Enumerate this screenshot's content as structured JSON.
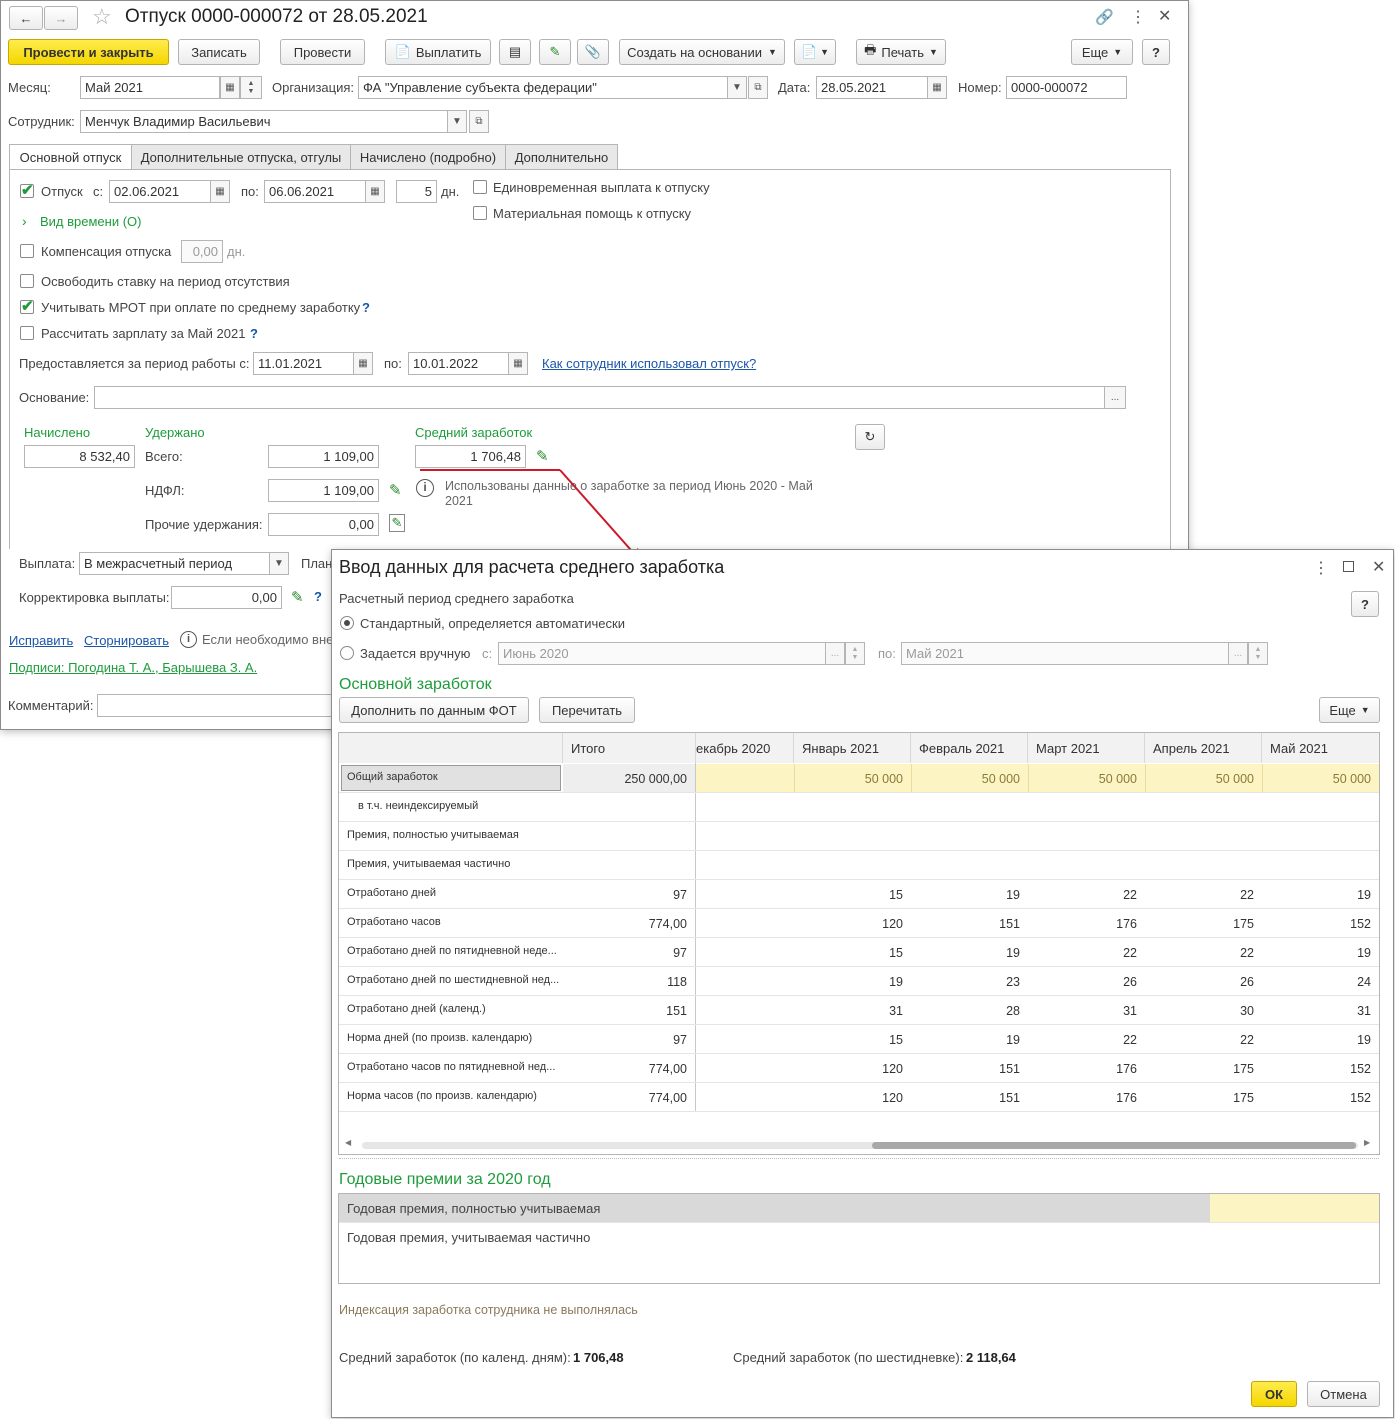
{
  "main_window": {
    "title": "Отпуск 0000-000072 от 28.05.2021",
    "toolbar": {
      "post_close": "Провести и закрыть",
      "save": "Записать",
      "post": "Провести",
      "pay": "Выплатить",
      "create_based": "Создать на основании",
      "print": "Печать",
      "more": "Еще",
      "help": "?"
    },
    "header": {
      "month_label": "Месяц:",
      "month_value": "Май 2021",
      "org_label": "Организация:",
      "org_value": "ФА \"Управление субъекта федерации\"",
      "date_label": "Дата:",
      "date_value": "28.05.2021",
      "number_label": "Номер:",
      "number_value": "0000-000072",
      "employee_label": "Сотрудник:",
      "employee_value": "Менчук Владимир Васильевич"
    },
    "tabs": [
      "Основной отпуск",
      "Дополнительные отпуска, отгулы",
      "Начислено (подробно)",
      "Дополнительно"
    ],
    "leave": {
      "vacation_label": "Отпуск",
      "from_label": "с:",
      "from_value": "02.06.2021",
      "to_label": "по:",
      "to_value": "06.06.2021",
      "days_value": "5",
      "days_unit": "дн.",
      "lump_sum": "Единовременная выплата к отпуску",
      "material_aid": "Материальная помощь к отпуску",
      "time_type": "Вид времени (О)",
      "compensation": "Компенсация отпуска",
      "compensation_value": "0,00",
      "compensation_unit": "дн.",
      "free_rate": "Освободить ставку на период отсутствия",
      "mrot": "Учитывать МРОТ при оплате по среднему заработку",
      "calc_salary": "Рассчитать зарплату за Май 2021",
      "period_label": "Предоставляется за период работы с:",
      "period_from": "11.01.2021",
      "period_to_label": "по:",
      "period_to": "10.01.2022",
      "usage_link": "Как сотрудник использовал отпуск?",
      "basis_label": "Основание:"
    },
    "totals": {
      "accrued_label": "Начислено",
      "accrued_value": "8 532,40",
      "withheld_label": "Удержано",
      "total_label": "Всего:",
      "total_value": "1 109,00",
      "ndfl_label": "НДФЛ:",
      "ndfl_value": "1 109,00",
      "other_label": "Прочие удержания:",
      "other_value": "0,00",
      "avg_label": "Средний заработок",
      "avg_value": "1 706,48",
      "info_text": "Использованы данные о заработке за период Июнь 2020 - Май 2021"
    },
    "payment": {
      "pay_label": "Выплата:",
      "pay_value": "В межрасчетный период",
      "plan_label": "План",
      "correction_label": "Корректировка выплаты:",
      "correction_value": "0,00"
    },
    "footer": {
      "fix_link": "Исправить",
      "reverse_link": "Сторнировать",
      "note_text": "Если необходимо вне",
      "signatures_link": "Подписи: Погодина Т. А., Барышева З. А.",
      "comment_label": "Комментарий:"
    }
  },
  "dialog": {
    "title": "Ввод данных для расчета среднего заработка",
    "period_section": "Расчетный период среднего заработка",
    "radio_auto": "Стандартный, определяется автоматически",
    "radio_manual": "Задается вручную",
    "manual_from_label": "с:",
    "manual_from": "Июнь 2020",
    "manual_to_label": "по:",
    "manual_to": "Май 2021",
    "base_section": "Основной заработок",
    "fill_button": "Дополнить по данным ФОТ",
    "reread_button": "Перечитать",
    "more_button": "Еще",
    "help": "?",
    "table": {
      "columns": [
        "",
        "Итого",
        "екабрь 2020",
        "Январь 2021",
        "Февраль 2021",
        "Март 2021",
        "Апрель 2021",
        "Май 2021"
      ],
      "rows": [
        {
          "label": "Общий заработок",
          "total": "250 000,00",
          "values": [
            "",
            "50 000",
            "50 000",
            "50 000",
            "50 000",
            "50 000"
          ]
        },
        {
          "label": "в т.ч. неиндексируемый",
          "total": "",
          "values": [
            "",
            "",
            "",
            "",
            "",
            ""
          ]
        },
        {
          "label": "Премия, полностью учитываемая",
          "total": "",
          "values": [
            "",
            "",
            "",
            "",
            "",
            ""
          ]
        },
        {
          "label": "Премия, учитываемая частично",
          "total": "",
          "values": [
            "",
            "",
            "",
            "",
            "",
            ""
          ]
        },
        {
          "label": "Отработано дней",
          "total": "97",
          "values": [
            "",
            "15",
            "19",
            "22",
            "22",
            "19"
          ]
        },
        {
          "label": "Отработано часов",
          "total": "774,00",
          "values": [
            "",
            "120",
            "151",
            "176",
            "175",
            "152"
          ]
        },
        {
          "label": "Отработано дней по пятидневной неде...",
          "total": "97",
          "values": [
            "",
            "15",
            "19",
            "22",
            "22",
            "19"
          ]
        },
        {
          "label": "Отработано дней по шестидневной нед...",
          "total": "118",
          "values": [
            "",
            "19",
            "23",
            "26",
            "26",
            "24"
          ]
        },
        {
          "label": "Отработано дней (календ.)",
          "total": "151",
          "values": [
            "",
            "31",
            "28",
            "31",
            "30",
            "31"
          ]
        },
        {
          "label": "Норма дней (по произв. календарю)",
          "total": "97",
          "values": [
            "",
            "15",
            "19",
            "22",
            "22",
            "19"
          ]
        },
        {
          "label": "Отработано часов по пятидневной нед...",
          "total": "774,00",
          "values": [
            "",
            "120",
            "151",
            "176",
            "175",
            "152"
          ]
        },
        {
          "label": "Норма часов (по произв. календарю)",
          "total": "774,00",
          "values": [
            "",
            "120",
            "151",
            "176",
            "175",
            "152"
          ]
        }
      ]
    },
    "bonus_section": "Годовые премии за 2020 год",
    "bonus_rows": [
      "Годовая премия, полностью учитываемая",
      "Годовая премия, учитываемая частично"
    ],
    "indexation_text": "Индексация заработка сотрудника не выполнялась",
    "avg_calendar_label": "Средний заработок (по календ. дням):",
    "avg_calendar_value": "1 706,48",
    "avg_six_label": "Средний заработок (по шестидневке):",
    "avg_six_value": "2 118,64",
    "ok_button": "ОК",
    "cancel_button": "Отмена"
  }
}
